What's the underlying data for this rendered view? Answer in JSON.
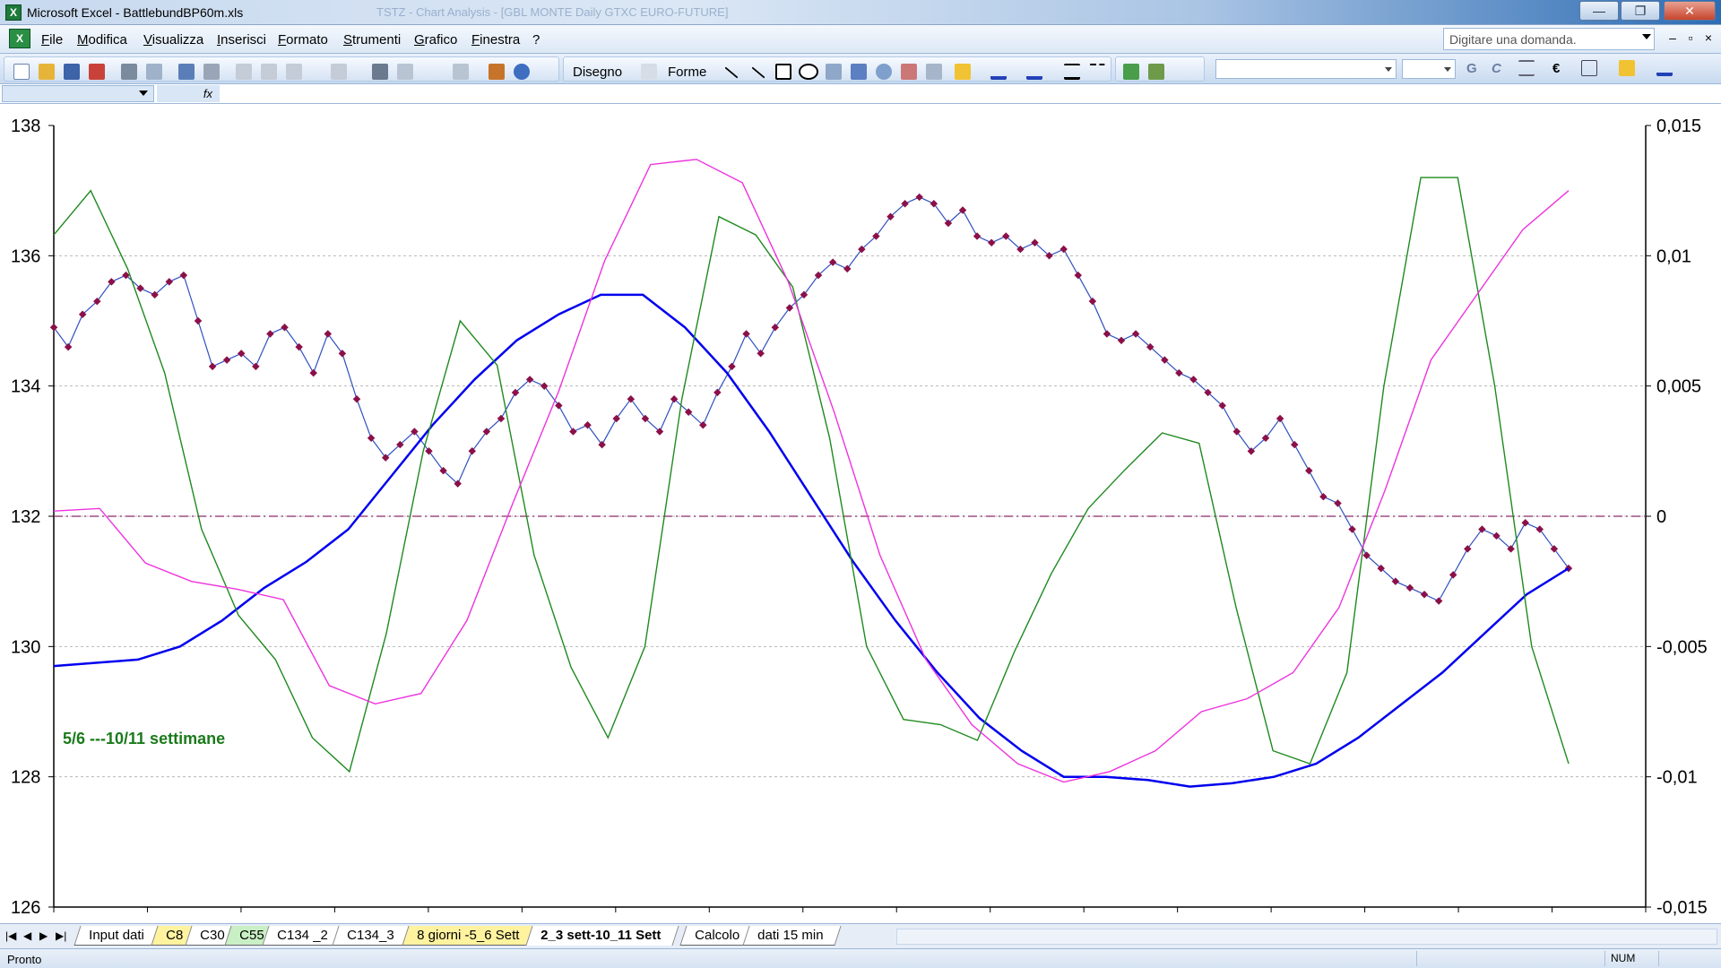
{
  "window": {
    "title": "Microsoft Excel - BattlebundBP60m.xls",
    "ghost_title": "TSTZ - Chart Analysis - [GBL MONTE Daily  GTXC EURO-FUTURE]",
    "minimize": "—",
    "maximize": "❐",
    "close": "✕"
  },
  "menu": {
    "items": [
      "File",
      "Modifica",
      "Visualizza",
      "Inserisci",
      "Formato",
      "Strumenti",
      "Grafico",
      "Finestra",
      "?"
    ],
    "help_placeholder": "Digitare una domanda."
  },
  "toolbar": {
    "disegno": "Disegno",
    "forme": "Forme",
    "bold": "G",
    "italic": "C",
    "euro": "€"
  },
  "formula_bar": {
    "fx": "fx"
  },
  "chart_data": {
    "type": "line",
    "title": "",
    "annotation": "5/6 ---10/11 settimane",
    "y_left": {
      "ticks": [
        "138",
        "136",
        "134",
        "132",
        "130",
        "128",
        "126"
      ],
      "range": [
        126,
        138
      ]
    },
    "y_right": {
      "ticks": [
        "0,015",
        "0,01",
        "0,005",
        "0",
        "-0,005",
        "-0,01",
        "-0,015"
      ],
      "range": [
        -0.015,
        0.015
      ]
    },
    "x_count": 17,
    "zero_line_value": 0,
    "series": [
      {
        "color": "#8b1048",
        "axis": "left",
        "marker": "diamond",
        "values": [
          134.9,
          134.6,
          135.1,
          135.3,
          135.6,
          135.7,
          135.5,
          135.4,
          135.6,
          135.7,
          135.0,
          134.3,
          134.4,
          134.5,
          134.3,
          134.8,
          134.9,
          134.6,
          134.2,
          134.8,
          134.5,
          133.8,
          133.2,
          132.9,
          133.1,
          133.3,
          133.0,
          132.7,
          132.5,
          133.0,
          133.3,
          133.5,
          133.9,
          134.1,
          134.0,
          133.7,
          133.3,
          133.4,
          133.1,
          133.5,
          133.8,
          133.5,
          133.3,
          133.8,
          133.6,
          133.4,
          133.9,
          134.3,
          134.8,
          134.5,
          134.9,
          135.2,
          135.4,
          135.7,
          135.9,
          135.8,
          136.1,
          136.3,
          136.6,
          136.8,
          136.9,
          136.8,
          136.5,
          136.7,
          136.3,
          136.2,
          136.3,
          136.1,
          136.2,
          136.0,
          136.1,
          135.7,
          135.3,
          134.8,
          134.7,
          134.8,
          134.6,
          134.4,
          134.2,
          134.1,
          133.9,
          133.7,
          133.3,
          133.0,
          133.2,
          133.5,
          133.1,
          132.7,
          132.3,
          132.2,
          131.8,
          131.4,
          131.2,
          131.0,
          130.9,
          130.8,
          130.7,
          131.1,
          131.5,
          131.8,
          131.7,
          131.5,
          131.9,
          131.8,
          131.5,
          131.2
        ]
      },
      {
        "color": "#0000ee",
        "axis": "left",
        "marker": "none",
        "values": [
          129.7,
          129.75,
          129.8,
          130.0,
          130.4,
          130.9,
          131.3,
          131.8,
          132.6,
          133.4,
          134.1,
          134.7,
          135.1,
          135.4,
          135.4,
          134.9,
          134.2,
          133.3,
          132.3,
          131.3,
          130.4,
          129.6,
          128.9,
          128.4,
          128.0,
          128.0,
          127.95,
          127.85,
          127.9,
          128.0,
          128.2,
          128.6,
          129.1,
          129.6,
          130.2,
          130.8,
          131.2
        ]
      },
      {
        "color": "#1f8a1f",
        "axis": "right",
        "marker": "none",
        "values": [
          0.0108,
          0.0125,
          0.0095,
          0.0055,
          -0.0005,
          -0.0038,
          -0.0055,
          -0.0085,
          -0.0098,
          -0.0045,
          0.0025,
          0.0075,
          0.0058,
          -0.0015,
          -0.0058,
          -0.0085,
          -0.005,
          0.0045,
          0.0115,
          0.0108,
          0.0088,
          0.003,
          -0.005,
          -0.0078,
          -0.008,
          -0.0086,
          -0.0052,
          -0.0022,
          0.0003,
          0.0018,
          0.0032,
          0.0028,
          -0.0035,
          -0.009,
          -0.0095,
          -0.006,
          0.005,
          0.013,
          0.013,
          0.005,
          -0.005,
          -0.0095
        ]
      },
      {
        "color": "#ee33dd",
        "axis": "right",
        "marker": "none",
        "values": [
          0.0002,
          0.0003,
          -0.0018,
          -0.0025,
          -0.0028,
          -0.0032,
          -0.0065,
          -0.0072,
          -0.0068,
          -0.004,
          0.0005,
          0.0048,
          0.0098,
          0.0135,
          0.0137,
          0.0128,
          0.009,
          0.004,
          -0.0015,
          -0.0055,
          -0.008,
          -0.0095,
          -0.0102,
          -0.0098,
          -0.009,
          -0.0075,
          -0.007,
          -0.006,
          -0.0035,
          0.001,
          0.006,
          0.0085,
          0.011,
          0.0125
        ]
      }
    ],
    "gridlines": true
  },
  "sheet_tabs": [
    {
      "label": "Input dati",
      "style": "plain"
    },
    {
      "label": "C8",
      "style": "yellow"
    },
    {
      "label": "C30",
      "style": "plain"
    },
    {
      "label": "C55",
      "style": "green"
    },
    {
      "label": "C134 _2",
      "style": "plain"
    },
    {
      "label": "C134_3",
      "style": "plain"
    },
    {
      "label": "8 giorni -5_6 Sett",
      "style": "yellow"
    },
    {
      "label": "2_3 sett-10_11 Sett",
      "style": "active"
    },
    {
      "label": "Calcolo",
      "style": "plain"
    },
    {
      "label": "dati 15 min",
      "style": "plain"
    }
  ],
  "status": {
    "text": "Pronto",
    "num": "NUM"
  }
}
